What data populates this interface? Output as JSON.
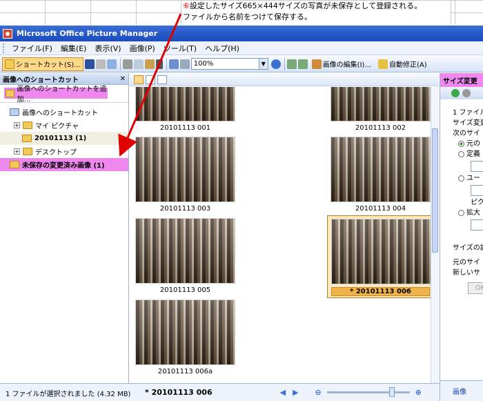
{
  "annotation": {
    "marker": "⑥",
    "line1": "設定したサイズ665×444サイズの写真が未保存として登録される。",
    "line2": "ファイルから名前をつけて保存する。"
  },
  "window": {
    "title": "Microsoft Office Picture Manager"
  },
  "menu": [
    "ファイル(F)",
    "編集(E)",
    "表示(V)",
    "画像(P)",
    "ツール(T)",
    "ヘルプ(H)"
  ],
  "toolbar": {
    "shortcut_label": "ショートカット(S)...",
    "zoom_value": "100%",
    "edit_label": "画像の編集(I)...",
    "autofix_label": "自動修正(A)"
  },
  "left_pane": {
    "title": "画像へのショートカット",
    "add_shortcut": "画像へのショートカットを追加...",
    "tree": [
      {
        "label": "画像へのショートカット",
        "level": 0
      },
      {
        "label": "マイ ピクチャ",
        "level": 1
      },
      {
        "label": "20101113 (1)",
        "level": 2
      },
      {
        "label": "デスクトップ",
        "level": 1
      },
      {
        "label": "未保存の変更済み画像 (1)",
        "level": 0
      }
    ]
  },
  "thumbnails": [
    {
      "caption": "20101113 001"
    },
    {
      "caption": "20101113 002"
    },
    {
      "caption": "20101113 003"
    },
    {
      "caption": "20101113 004"
    },
    {
      "caption": "20101113 005"
    },
    {
      "caption": "* 20101113 006"
    },
    {
      "caption": "20101113 006a"
    }
  ],
  "status": {
    "text": "1 ファイルが選択されました (4.32 MB)"
  },
  "bottom": {
    "filename": "* 20101113 006"
  },
  "right_pane": {
    "title": "サイズ変更",
    "lines": [
      "1 ファイル",
      "サイズ変更",
      "次のサイ",
      "元の",
      "定義",
      "ユー",
      "ピク",
      "拡大",
      "サイズの設",
      "元のサイ",
      "新しいサ"
    ],
    "ok": "OK",
    "footer": "画像"
  },
  "colors": {
    "highlight": "#ee88ee",
    "arrow": "#e00000",
    "title_blue": "#2456c6"
  }
}
